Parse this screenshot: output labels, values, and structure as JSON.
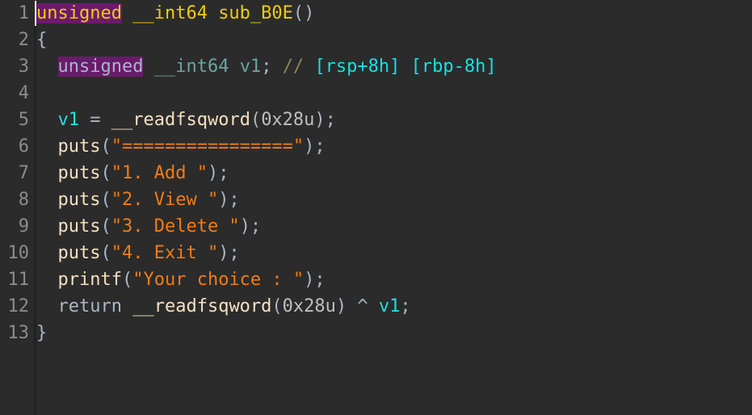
{
  "editor": {
    "name": "decompiler-pseudocode-view",
    "background_color": "#2b2b2b",
    "highlight_color": "#6b1a6b",
    "cursor_color": "#ffffff",
    "gutter": {
      "line_numbers": [
        "1",
        "2",
        "3",
        "4",
        "5",
        "6",
        "7",
        "8",
        "9",
        "10",
        "11",
        "12",
        "13"
      ]
    },
    "lines": [
      {
        "number": "1",
        "tokens": [
          {
            "text": "unsigned",
            "style": "tok-yellow hl-purple"
          },
          {
            "text": " ",
            "style": "tok-plain"
          },
          {
            "text": "__int64",
            "style": "tok-funcname"
          },
          {
            "text": " ",
            "style": "tok-plain"
          },
          {
            "text": "sub_B0E",
            "style": "tok-funcname"
          },
          {
            "text": "()",
            "style": "tok-punct"
          }
        ]
      },
      {
        "number": "2",
        "tokens": [
          {
            "text": "{",
            "style": "tok-brace"
          }
        ]
      },
      {
        "number": "3",
        "tokens": [
          {
            "text": "  ",
            "style": "tok-plain"
          },
          {
            "text": "unsigned",
            "style": "tok-keyword hl-purple"
          },
          {
            "text": " ",
            "style": "tok-plain"
          },
          {
            "text": "__int64",
            "style": "tok-type"
          },
          {
            "text": " ",
            "style": "tok-plain"
          },
          {
            "text": "v1",
            "style": "tok-type"
          },
          {
            "text": ";",
            "style": "tok-punct"
          },
          {
            "text": " ",
            "style": "tok-plain"
          },
          {
            "text": "//",
            "style": "tok-comment"
          },
          {
            "text": " ",
            "style": "tok-plain"
          },
          {
            "text": "[rsp+8h] [rbp-8h]",
            "style": "tok-cmtcyan"
          }
        ]
      },
      {
        "number": "4",
        "tokens": []
      },
      {
        "number": "5",
        "tokens": [
          {
            "text": "  ",
            "style": "tok-plain"
          },
          {
            "text": "v1",
            "style": "tok-var"
          },
          {
            "text": " = ",
            "style": "tok-punct"
          },
          {
            "text": "__readfsqword",
            "style": "tok-func"
          },
          {
            "text": "(",
            "style": "tok-punct"
          },
          {
            "text": "0x28u",
            "style": "tok-number"
          },
          {
            "text": ");",
            "style": "tok-punct"
          }
        ]
      },
      {
        "number": "6",
        "tokens": [
          {
            "text": "  ",
            "style": "tok-plain"
          },
          {
            "text": "puts",
            "style": "tok-func"
          },
          {
            "text": "(",
            "style": "tok-punct"
          },
          {
            "text": "\"================\"",
            "style": "tok-string"
          },
          {
            "text": ");",
            "style": "tok-punct"
          }
        ]
      },
      {
        "number": "7",
        "tokens": [
          {
            "text": "  ",
            "style": "tok-plain"
          },
          {
            "text": "puts",
            "style": "tok-func"
          },
          {
            "text": "(",
            "style": "tok-punct"
          },
          {
            "text": "\"1. Add \"",
            "style": "tok-string"
          },
          {
            "text": ");",
            "style": "tok-punct"
          }
        ]
      },
      {
        "number": "8",
        "tokens": [
          {
            "text": "  ",
            "style": "tok-plain"
          },
          {
            "text": "puts",
            "style": "tok-func"
          },
          {
            "text": "(",
            "style": "tok-punct"
          },
          {
            "text": "\"2. View \"",
            "style": "tok-string"
          },
          {
            "text": ");",
            "style": "tok-punct"
          }
        ]
      },
      {
        "number": "9",
        "tokens": [
          {
            "text": "  ",
            "style": "tok-plain"
          },
          {
            "text": "puts",
            "style": "tok-func"
          },
          {
            "text": "(",
            "style": "tok-punct"
          },
          {
            "text": "\"3. Delete \"",
            "style": "tok-string"
          },
          {
            "text": ");",
            "style": "tok-punct"
          }
        ]
      },
      {
        "number": "10",
        "tokens": [
          {
            "text": "  ",
            "style": "tok-plain"
          },
          {
            "text": "puts",
            "style": "tok-func"
          },
          {
            "text": "(",
            "style": "tok-punct"
          },
          {
            "text": "\"4. Exit \"",
            "style": "tok-string"
          },
          {
            "text": ");",
            "style": "tok-punct"
          }
        ]
      },
      {
        "number": "11",
        "tokens": [
          {
            "text": "  ",
            "style": "tok-plain"
          },
          {
            "text": "printf",
            "style": "tok-func"
          },
          {
            "text": "(",
            "style": "tok-punct"
          },
          {
            "text": "\"Your choice : \"",
            "style": "tok-string"
          },
          {
            "text": ");",
            "style": "tok-punct"
          }
        ]
      },
      {
        "number": "12",
        "tokens": [
          {
            "text": "  ",
            "style": "tok-plain"
          },
          {
            "text": "return",
            "style": "tok-keyword"
          },
          {
            "text": " ",
            "style": "tok-plain"
          },
          {
            "text": "__readfsqword",
            "style": "tok-func"
          },
          {
            "text": "(",
            "style": "tok-punct"
          },
          {
            "text": "0x28u",
            "style": "tok-number"
          },
          {
            "text": ") ^ ",
            "style": "tok-punct"
          },
          {
            "text": "v1",
            "style": "tok-var"
          },
          {
            "text": ";",
            "style": "tok-punct"
          }
        ]
      },
      {
        "number": "13",
        "tokens": [
          {
            "text": "}",
            "style": "tok-brace"
          }
        ]
      }
    ]
  }
}
